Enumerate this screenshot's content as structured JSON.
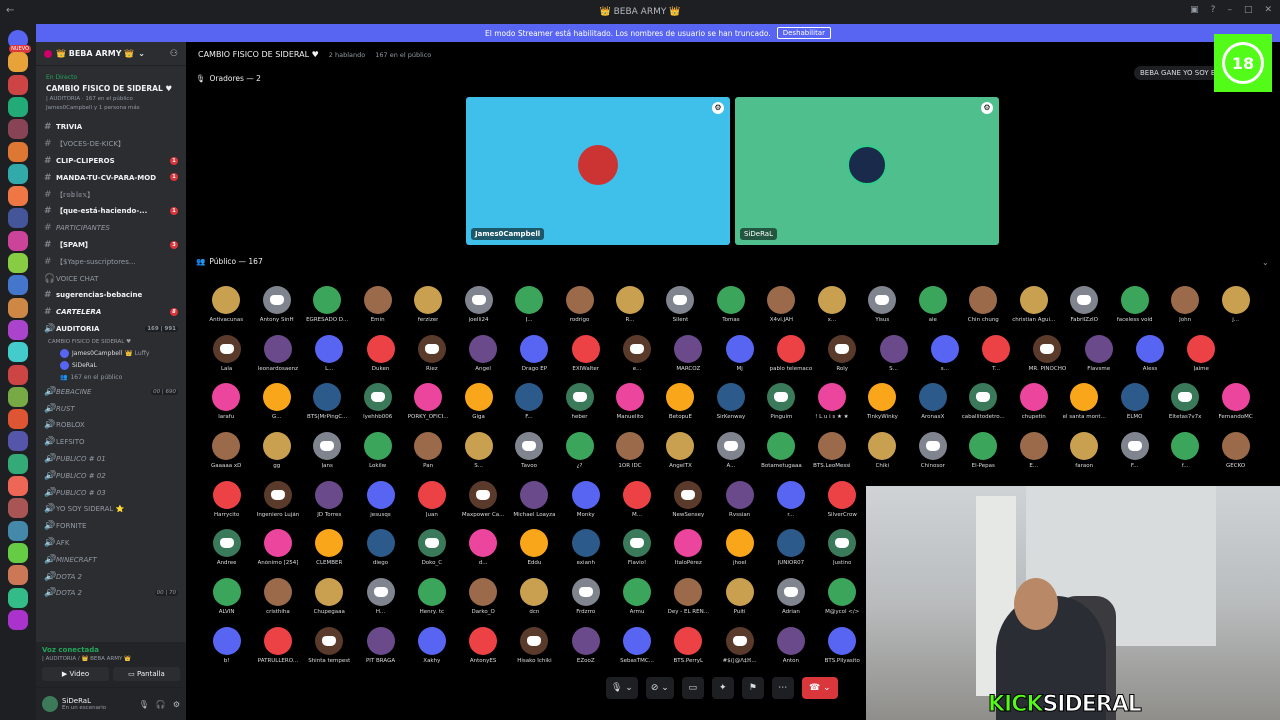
{
  "window": {
    "title": "👑 BEBA ARMY 👑"
  },
  "banner": {
    "text": "El modo Streamer está habilitado. Los nombres de usuario se han truncado.",
    "button": "Deshabilitar"
  },
  "guilds": {
    "new_label": "NUEVO"
  },
  "server": {
    "name": "👑 BEBA ARMY 👑"
  },
  "live_card": {
    "status": "En Directo",
    "title": "CAMBIO FISICO DE SIDERAL ♥",
    "category": "| AUDITORIA · 167 en el público",
    "viewers": "James0Campbell y 1 persona más"
  },
  "channels": [
    {
      "label": "TRIVIA",
      "bold": true,
      "icon": "#"
    },
    {
      "label": "【VOCES-DE-KICK】",
      "icon": "#"
    },
    {
      "label": "CLIP-CLIPEROS",
      "bold": true,
      "icon": "#",
      "unread": "1"
    },
    {
      "label": "MANDA-TU-CV-PARA-MOD",
      "bold": true,
      "icon": "#",
      "unread": "1"
    },
    {
      "label": "【𝕣𝕠𝕓𝕝𝕠𝕩】",
      "icon": "#"
    },
    {
      "label": "【que-está-haciendo-...",
      "bold": true,
      "icon": "#",
      "unread": "1"
    },
    {
      "label": "PARTICIPANTES",
      "italic": true,
      "icon": "#"
    },
    {
      "label": "【SPAM】",
      "bold": true,
      "icon": "#",
      "unread": "3"
    },
    {
      "label": "【$Yape-suscriptores...",
      "icon": "#"
    },
    {
      "label": "VOICE CHAT",
      "icon": ""
    },
    {
      "label": "sugerencias-bebacine",
      "bold": true,
      "icon": "#"
    },
    {
      "label": "CARTELERA",
      "bold": true,
      "italic": true,
      "icon": "#",
      "unread": "8"
    },
    {
      "label": "AUDITORIA",
      "bold": true,
      "icon": "🔊",
      "count": "169 | 991"
    }
  ],
  "stage_channel_sub": "CAMBIO FISICO DE SIDERAL ♥",
  "voice_users": [
    {
      "name": "James0Campbell",
      "tag": "👑 Luffy"
    },
    {
      "name": "SiDeRaL",
      "tag": ""
    }
  ],
  "audience_count_label": "167 en el público",
  "channels2": [
    {
      "label": "BEBACINE",
      "italic": true,
      "count": "00 | 690"
    },
    {
      "label": "RUST",
      "italic": true
    },
    {
      "label": "ROBLOX"
    },
    {
      "label": "LEFSITO"
    },
    {
      "label": "PUBLICO # 01",
      "italic": true
    },
    {
      "label": "PUBLICO # 02",
      "italic": true
    },
    {
      "label": "PUBLICO # 03",
      "italic": true
    },
    {
      "label": "YO SOY SIDERAL ⭐"
    },
    {
      "label": "FORNITE"
    },
    {
      "label": "AFK"
    },
    {
      "label": "MINECRAFT",
      "italic": true
    },
    {
      "label": "DOTA 2",
      "italic": true
    },
    {
      "label": "DOTA 2",
      "italic": true,
      "count": "00 | 70"
    }
  ],
  "voice_panel": {
    "status": "Voz conectada",
    "location": "| AUDITORIA / 👑 BEBA ARMY 👑",
    "video": "Video",
    "screen": "Pantalla"
  },
  "user_panel": {
    "name": "SiDeRaL",
    "status": "En un escenario"
  },
  "stage": {
    "title": "CAMBIO FISICO DE SIDERAL ♥",
    "speaking": "2 hablando",
    "audience": "167 en el público",
    "speakers_label": "Oradores — 2",
    "public_label": "Público — 167"
  },
  "speakers": [
    {
      "name": "James0Campbell",
      "bg": "#3ec0ea"
    },
    {
      "name": "SiDeRaL",
      "bg": "#4fbf8e"
    }
  ],
  "notice": "BEBA GANE YO SOY EL",
  "age_badge": "18",
  "kick": {
    "kick": "KICK",
    "name": "SIDERAL"
  },
  "audience_rows": [
    [
      "Antivacunas",
      "Antony SinH",
      "EGRESADO D...",
      "Emin",
      "ferzizer",
      "joelli24",
      "J...",
      "rodrigo",
      "R...",
      "Silent",
      "Tomas",
      "X4vi.JAH",
      "x...",
      "Yisus",
      "ale",
      "Chin chung",
      "christian Agui...",
      "FabrilZzIO",
      "faceless void",
      "John",
      "j..."
    ],
    [
      "Lala",
      "leonardosaenz",
      "L...",
      "Duken",
      "Riez",
      "Angel",
      "Drago EP",
      "EXIWalter",
      "e...",
      "MARCOZ",
      "Mj",
      "pablo telemaco",
      "Roly",
      "S...",
      "s...",
      "T...",
      "MR. PINOCHO",
      "Flavsme",
      "Aless",
      "Jaime"
    ],
    [
      "larafu",
      "G...",
      "BTS|MrPingC...",
      "lyehhb006",
      "PORKY_OFICI...",
      "Giga",
      "F...",
      "heber",
      "Manuelito",
      "BetopuE",
      "SirKenway",
      "Pinguim",
      "! L u i s ★ ★",
      "TinkyWinky",
      "AronaxX",
      "caballitodetro...",
      "chupetin",
      "el santa mont...",
      "ELMO",
      "Eltetas7v7x",
      "FernandoMC"
    ],
    [
      "Gaaaaa xD",
      "gg",
      "Jans",
      "Lokilw",
      "Pan",
      "S...",
      "Tavoo",
      "¿?",
      "1OR IDC",
      "AngelTX",
      "A...",
      "Botametugaaa",
      "BTS.LeoMessi",
      "Chiki",
      "Chinosor",
      "El-Pepas",
      "E...",
      "faraon",
      "F...",
      "f...",
      "GECKO"
    ],
    [
      "Harrycito",
      "Ingeniero Luján",
      "JD Torres",
      "jesusqs",
      "Juan",
      "Maxpower Ca...",
      "Michael Loayza",
      "Monky",
      "M...",
      "NewSensey",
      "Rvssian",
      "r...",
      "SilverCrow"
    ],
    [
      "Andree",
      "Anónimo [254]",
      "CLEMBER",
      "diego",
      "Doko_C",
      "d...",
      "Eddu",
      "exianh",
      "Flavio!",
      "ItaloPérez",
      "jhoel",
      "JUNIOR07",
      "Justino"
    ],
    [
      "ALVIN",
      "cristhiha",
      "Chupegaaa",
      "H...",
      "Henry. tc",
      "Darko_O",
      "dcn",
      "Frdzrro",
      "Armu",
      "Dey - EL REN...",
      "Puiti",
      "Adrian",
      "M@ycol </>"
    ],
    [
      "b!",
      "PATRULLERO...",
      "Shinta tempest",
      "PIT BRAGA",
      "Xakhy",
      "AntonyES",
      "Hisako Ichiki",
      "EZooZ",
      "SebasTMC...",
      "BTS.PerryL",
      "#$(|@Λ‡ℍ...",
      "Anton",
      "BTS.Pllyasito"
    ]
  ],
  "colors": {
    "accent": "#5865f2",
    "green": "#23a559",
    "red": "#da373c",
    "kick": "#53fc18"
  }
}
